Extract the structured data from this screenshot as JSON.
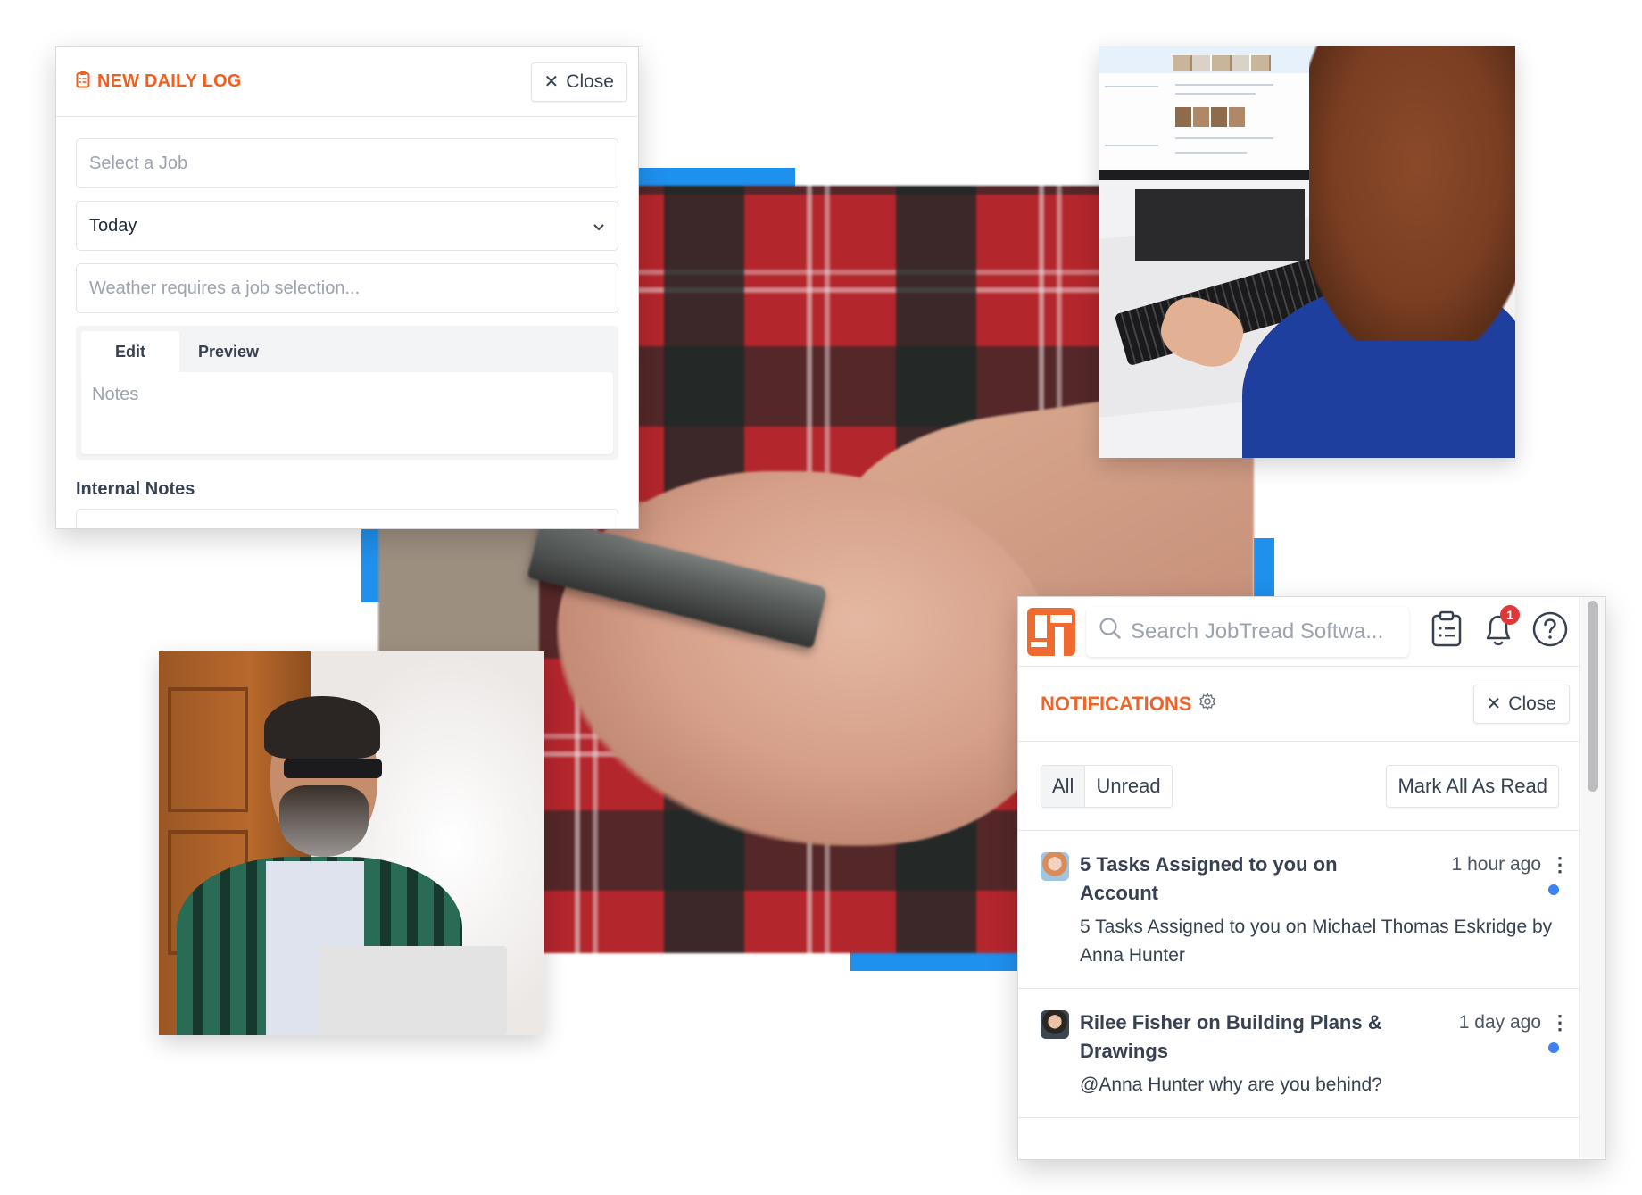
{
  "colors": {
    "brand_orange": "#f45d1c",
    "accent_blue": "#1e90ee",
    "unread_blue": "#3b82f6",
    "badge_red": "#dc3a3a"
  },
  "photos": {
    "center": "person holding smartphone wearing red plaid shirt",
    "top_right": "woman typing on keyboard at desktop computer",
    "bottom_left": "bearded man in sunglasses using laptop"
  },
  "daily_log": {
    "title_icon": "clipboard-list-icon",
    "title": "NEW DAILY LOG",
    "close_label": "Close",
    "job_placeholder": "Select a Job",
    "date_value": "Today",
    "weather_placeholder": "Weather requires a job selection...",
    "tabs": [
      {
        "label": "Edit",
        "active": true
      },
      {
        "label": "Preview",
        "active": false
      }
    ],
    "notes_placeholder": "Notes",
    "internal_notes_label": "Internal Notes"
  },
  "notifications": {
    "search_placeholder": "Search JobTread Softwa...",
    "bell_badge": "1",
    "title": "NOTIFICATIONS",
    "close_label": "Close",
    "filters": [
      {
        "label": "All",
        "active": true
      },
      {
        "label": "Unread",
        "active": false
      }
    ],
    "mark_all_label": "Mark All As Read",
    "items": [
      {
        "title": "5 Tasks Assigned to you on Account",
        "time": "1 hour ago",
        "body": "5 Tasks Assigned to you on Michael Thomas Eskridge by Anna Hunter",
        "unread": true
      },
      {
        "title": "Rilee Fisher on Building Plans & Drawings",
        "time": "1 day ago",
        "body": "@Anna Hunter why are you behind?",
        "unread": true
      }
    ]
  }
}
